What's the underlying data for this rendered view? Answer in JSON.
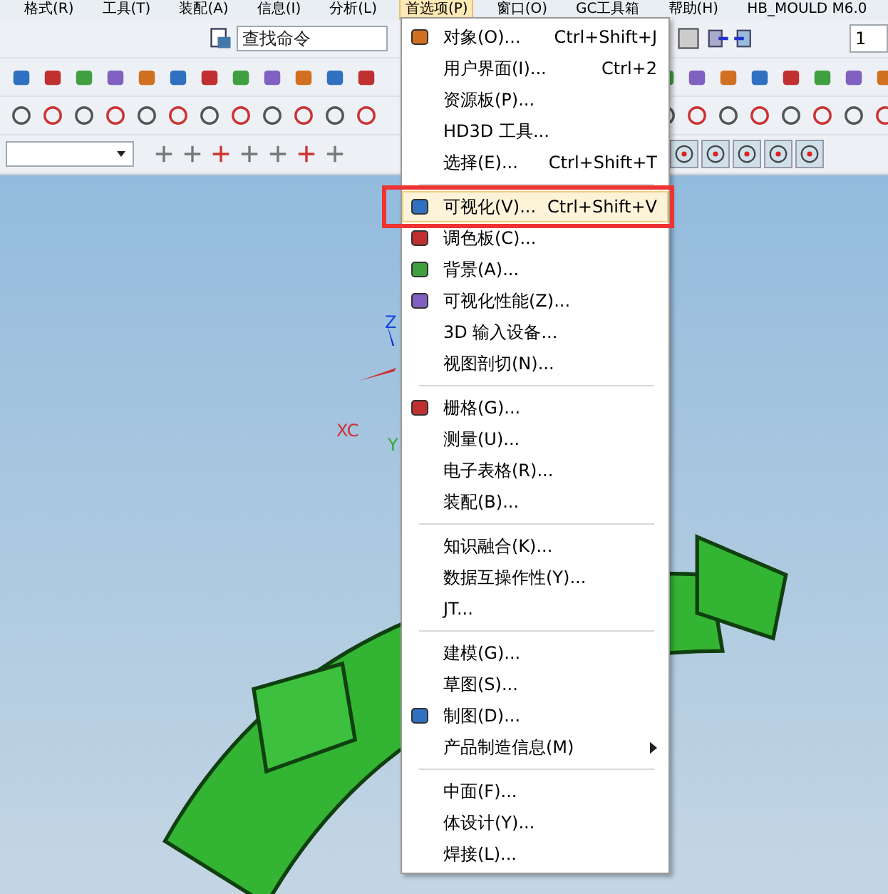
{
  "menu_bar": [
    {
      "label": "格式(R)",
      "selected": false
    },
    {
      "label": "工具(T)",
      "selected": false
    },
    {
      "label": "装配(A)",
      "selected": false
    },
    {
      "label": "信息(I)",
      "selected": false
    },
    {
      "label": "分析(L)",
      "selected": false
    },
    {
      "label": "首选项(P)",
      "selected": true
    },
    {
      "label": "窗口(O)",
      "selected": false
    },
    {
      "label": "GC工具箱",
      "selected": false
    },
    {
      "label": "帮助(H)",
      "selected": false
    },
    {
      "label": "HB_MOULD M6.0",
      "selected": false
    }
  ],
  "toolbar": {
    "search_placeholder": "查找命令",
    "layer_value": "1"
  },
  "viewport": {
    "axis_labels": [
      "Z",
      "XC",
      "Y"
    ]
  },
  "dropdown_menu": {
    "groups": [
      [
        {
          "label": "对象(O)...",
          "shortcut": "Ctrl+Shift+J",
          "has_icon": true,
          "selected": false,
          "submenu": false
        },
        {
          "label": "用户界面(I)...",
          "shortcut": "Ctrl+2",
          "has_icon": false,
          "selected": false,
          "submenu": false
        },
        {
          "label": "资源板(P)...",
          "has_icon": false,
          "selected": false,
          "submenu": false
        },
        {
          "label": "HD3D 工具...",
          "has_icon": false,
          "selected": false,
          "submenu": false
        },
        {
          "label": "选择(E)...",
          "shortcut": "Ctrl+Shift+T",
          "has_icon": false,
          "selected": false,
          "submenu": false
        }
      ],
      [
        {
          "label": "可视化(V)...",
          "shortcut": "Ctrl+Shift+V",
          "has_icon": true,
          "selected": true,
          "submenu": false
        },
        {
          "label": "调色板(C)...",
          "has_icon": true,
          "selected": false,
          "submenu": false
        },
        {
          "label": "背景(A)...",
          "has_icon": true,
          "selected": false,
          "submenu": false
        },
        {
          "label": "可视化性能(Z)...",
          "has_icon": true,
          "selected": false,
          "submenu": false
        },
        {
          "label": "3D 输入设备...",
          "has_icon": false,
          "selected": false,
          "submenu": false
        },
        {
          "label": "视图剖切(N)...",
          "has_icon": false,
          "selected": false,
          "submenu": false
        }
      ],
      [
        {
          "label": "栅格(G)...",
          "has_icon": true,
          "selected": false,
          "submenu": false
        },
        {
          "label": "测量(U)...",
          "has_icon": false,
          "selected": false,
          "submenu": false
        },
        {
          "label": "电子表格(R)...",
          "has_icon": false,
          "selected": false,
          "submenu": false
        },
        {
          "label": "装配(B)...",
          "has_icon": false,
          "selected": false,
          "submenu": false
        }
      ],
      [
        {
          "label": "知识融合(K)...",
          "has_icon": false,
          "selected": false,
          "submenu": false
        },
        {
          "label": "数据互操作性(Y)...",
          "has_icon": false,
          "selected": false,
          "submenu": false
        },
        {
          "label": "JT...",
          "has_icon": false,
          "selected": false,
          "submenu": false
        }
      ],
      [
        {
          "label": "建模(G)...",
          "has_icon": false,
          "selected": false,
          "submenu": false
        },
        {
          "label": "草图(S)...",
          "has_icon": false,
          "selected": false,
          "submenu": false
        },
        {
          "label": "制图(D)...",
          "has_icon": true,
          "selected": false,
          "submenu": false
        },
        {
          "label": "产品制造信息(M)",
          "has_icon": false,
          "selected": false,
          "submenu": true
        }
      ],
      [
        {
          "label": "中面(F)...",
          "has_icon": false,
          "selected": false,
          "submenu": false
        },
        {
          "label": "体设计(Y)...",
          "has_icon": false,
          "selected": false,
          "submenu": false
        },
        {
          "label": "焊接(L)...",
          "has_icon": false,
          "selected": false,
          "submenu": false
        }
      ]
    ]
  }
}
